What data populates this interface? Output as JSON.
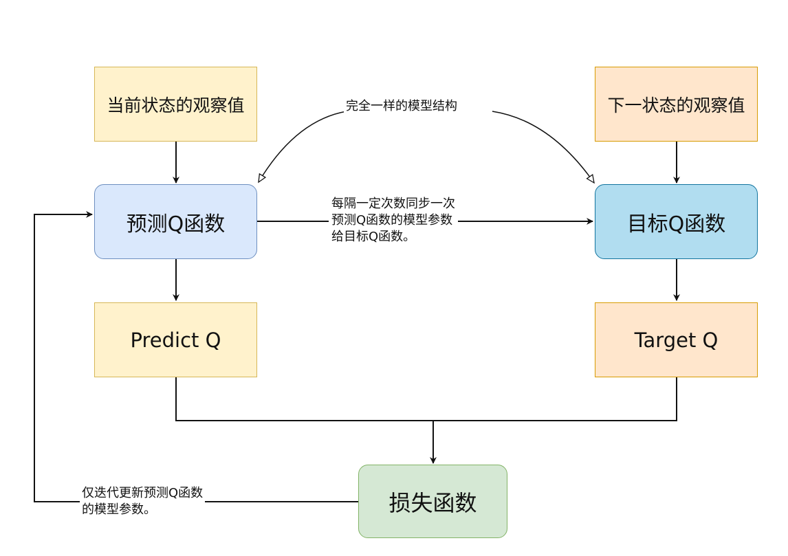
{
  "nodes": {
    "current_obs": "当前状态的观察值",
    "next_obs": "下一状态的观察值",
    "predict_q_func": "预测Q函数",
    "target_q_func": "目标Q函数",
    "predict_q": "Predict Q",
    "target_q": "Target Q",
    "loss": "损失函数"
  },
  "edge_labels": {
    "same_structure": "完全一样的模型结构",
    "sync_line1": "每隔一定次数同步一次",
    "sync_line2": "预测Q函数的模型参数",
    "sync_line3": "给目标Q函数。",
    "update_line1": "仅迭代更新预测Q函数",
    "update_line2": "的模型参数。"
  },
  "colors": {
    "edge": "#111111"
  }
}
